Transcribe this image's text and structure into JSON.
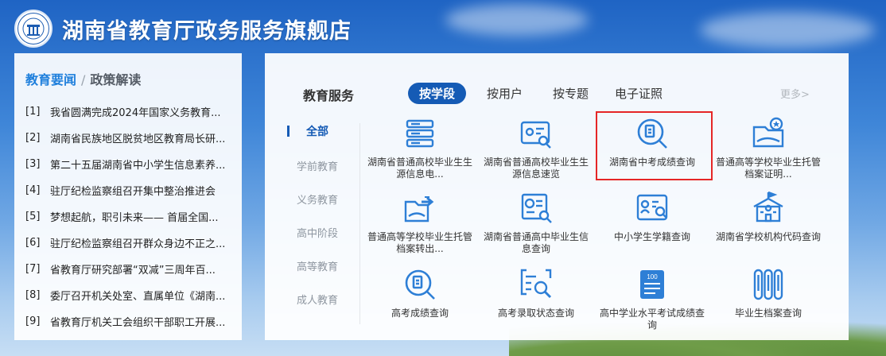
{
  "colors": {
    "primary": "#155bb5",
    "accent": "#1f7fdc",
    "icon": "#2e7fd6",
    "highlight": "#e52626"
  },
  "header": {
    "logo_icon": "education-bureau-emblem-icon",
    "title": "湖南省教育厅政务服务旗舰店"
  },
  "news": {
    "active_tab": "教育要闻",
    "separator": "/",
    "other_tab": "政策解读",
    "items": [
      {
        "num": "[1]",
        "text": "我省圆满完成2024年国家义务教育..."
      },
      {
        "num": "[2]",
        "text": "湖南省民族地区脱贫地区教育局长研..."
      },
      {
        "num": "[3]",
        "text": "第二十五届湖南省中小学生信息素养..."
      },
      {
        "num": "[4]",
        "text": "驻厅纪检监察组召开集中整治推进会"
      },
      {
        "num": "[5]",
        "text": "梦想起航，职引未来—— 首届全国..."
      },
      {
        "num": "[6]",
        "text": "驻厅纪检监察组召开群众身边不正之..."
      },
      {
        "num": "[7]",
        "text": "省教育厅研究部署“双减”三周年百..."
      },
      {
        "num": "[8]",
        "text": "委厅召开机关处室、直属单位《湖南..."
      },
      {
        "num": "[9]",
        "text": "省教育厅机关工会组织干部职工开展..."
      }
    ]
  },
  "services": {
    "label": "教育服务",
    "tabs": [
      "按学段",
      "按用户",
      "按专题",
      "电子证照"
    ],
    "more": "更多>",
    "categories": [
      "全部",
      "学前教育",
      "义务教育",
      "高中阶段",
      "高等教育",
      "成人教育"
    ],
    "cards": [
      {
        "icon": "database-stack-icon",
        "label": "湖南省普通高校毕业生生源信息电..."
      },
      {
        "icon": "id-card-search-icon",
        "label": "湖南省普通高校毕业生生源信息速览"
      },
      {
        "icon": "document-search-icon",
        "label": "湖南省中考成绩查询"
      },
      {
        "icon": "certificate-star-icon",
        "label": "普通高等学校毕业生托管档案证明..."
      },
      {
        "icon": "archive-transfer-icon",
        "label": "普通高等学校毕业生托管档案转出..."
      },
      {
        "icon": "certificate-search-icon",
        "label": "湖南省普通高中毕业生信息查询"
      },
      {
        "icon": "student-record-search-icon",
        "label": "中小学生学籍查询"
      },
      {
        "icon": "school-building-icon",
        "label": "湖南省学校机构代码查询"
      },
      {
        "icon": "document-search-icon",
        "label": "高考成绩查询"
      },
      {
        "icon": "screen-search-icon",
        "label": "高考录取状态查询"
      },
      {
        "icon": "score-sheet-icon",
        "score": "100",
        "label": "高中学业水平考试成绩查询"
      },
      {
        "icon": "archive-rolls-icon",
        "label": "毕业生档案查询"
      }
    ]
  }
}
